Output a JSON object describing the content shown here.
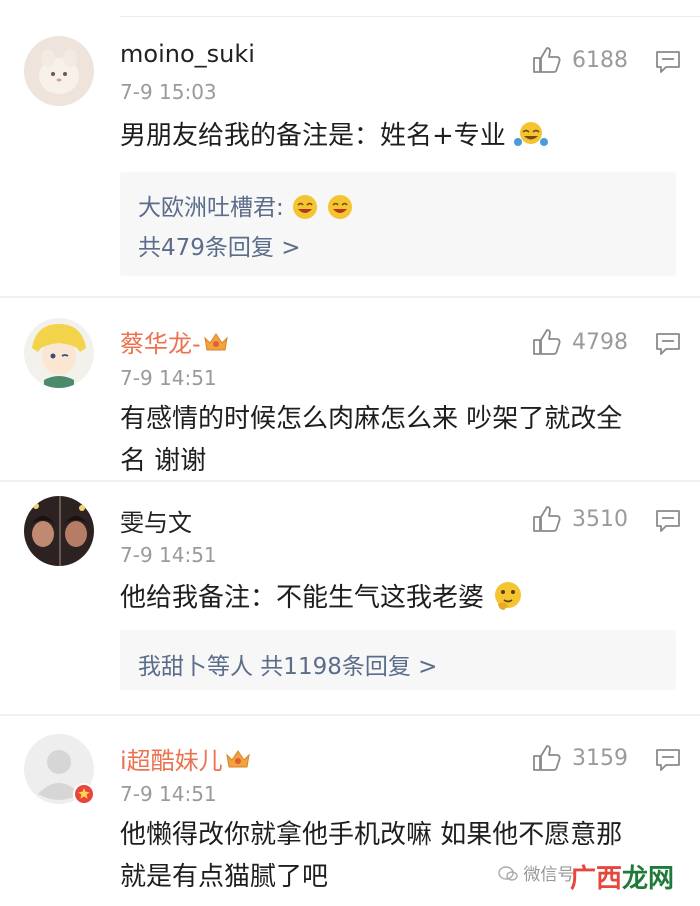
{
  "comments": [
    {
      "username": "moino_suki",
      "time": "7-9 15:03",
      "likes": "6188",
      "text": "男朋友给我的备注是：姓名+专业",
      "reply": {
        "line1": "大欧洲吐槽君:",
        "line2": "共479条回复 >"
      }
    },
    {
      "username": "蔡华龙-",
      "time": "7-9 14:51",
      "likes": "4798",
      "text_line1": "有感情的时候怎么肉麻怎么来 吵架了就改全",
      "text_line2": "名 谢谢"
    },
    {
      "username": "雯与文",
      "time": "7-9 14:51",
      "likes": "3510",
      "text": "他给我备注：不能生气这我老婆",
      "reply": {
        "line1": "我甜卜等人  共1198条回复 >"
      }
    },
    {
      "username": "i超酷妹儿",
      "time": "7-9 14:51",
      "likes": "3159",
      "text_line1": "他懒得改你就拿他手机改嘛 如果他不愿意那",
      "text_line2": "就是有点猫腻了吧"
    }
  ],
  "watermark": {
    "text": "微信号",
    "logo": "广西龙网"
  },
  "colors": {
    "vip_name": "#eb7350",
    "reply_link": "#5b6d8a"
  }
}
